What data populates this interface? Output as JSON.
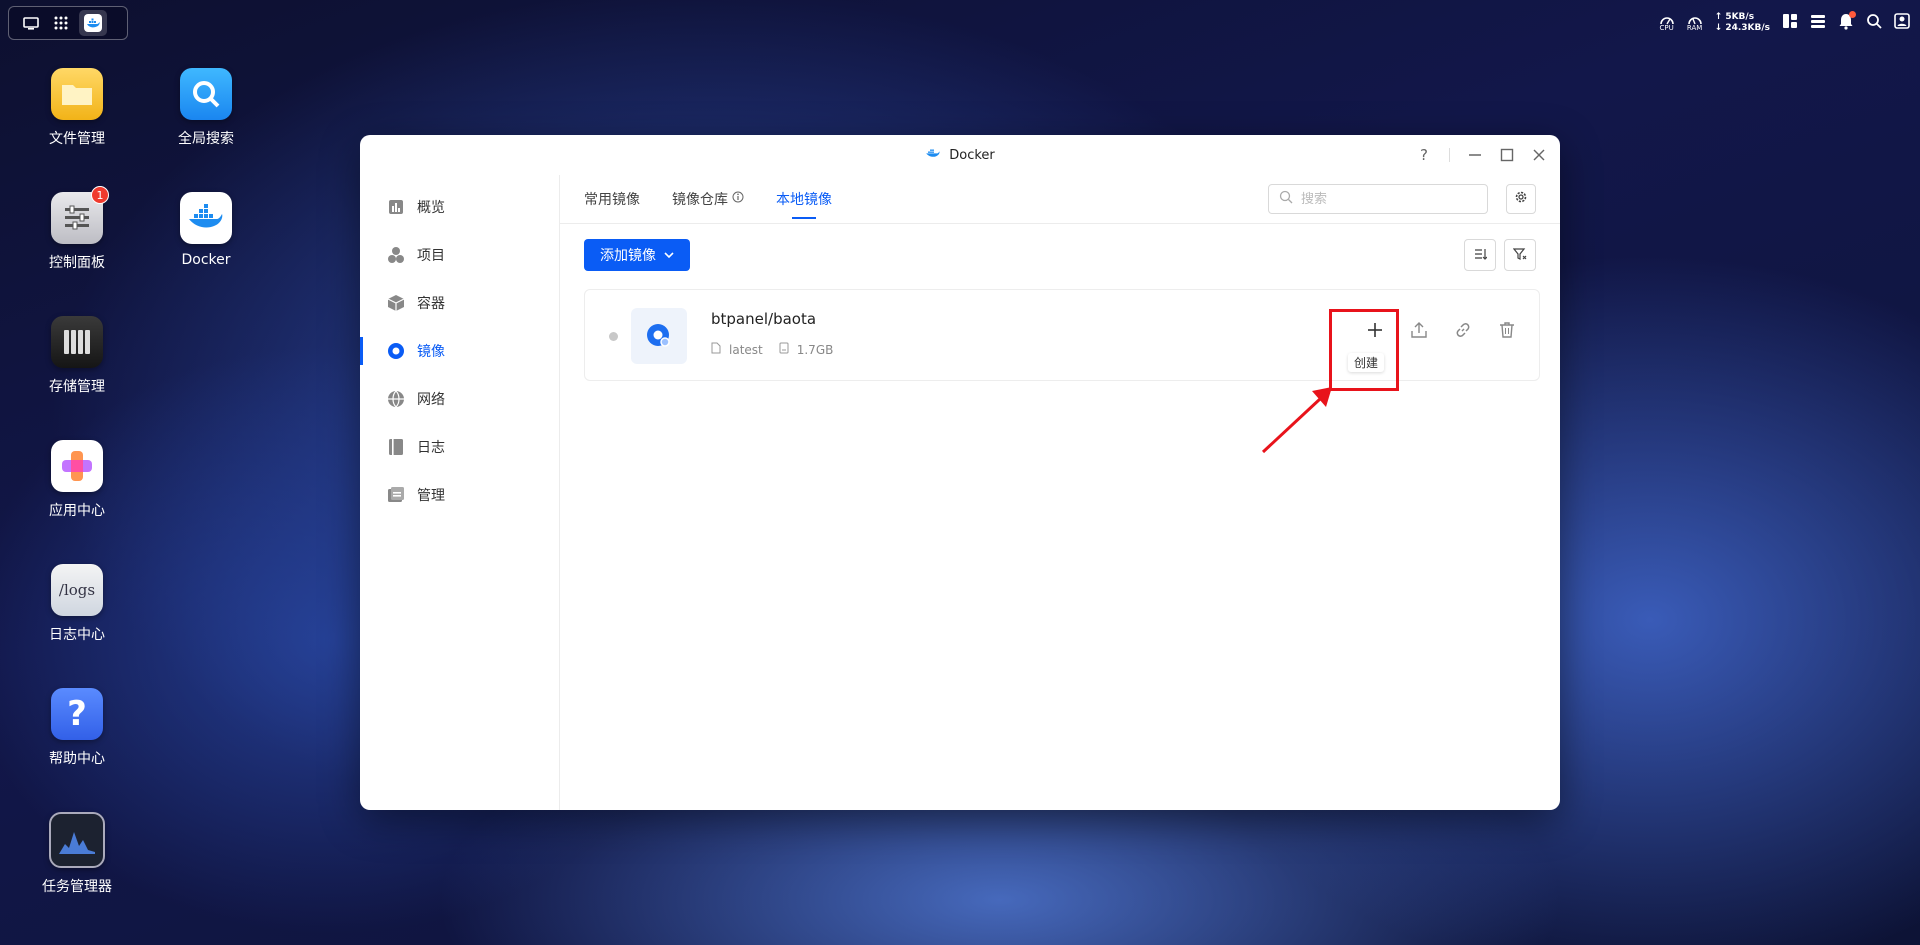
{
  "topbar": {
    "cpu_label": "CPU",
    "ram_label": "RAM",
    "upload_speed": "↑ 5KB/s",
    "download_speed": "↓ 24.3KB/s"
  },
  "desktop": {
    "icons": [
      {
        "label": "文件管理"
      },
      {
        "label": "全局搜索"
      },
      {
        "label": "控制面板",
        "badge": "1"
      },
      {
        "label": "Docker"
      },
      {
        "label": "存储管理"
      },
      {
        "label": "应用中心"
      },
      {
        "label": "日志中心",
        "tile_text": "/logs"
      },
      {
        "label": "帮助中心",
        "tile_text": "?"
      },
      {
        "label": "任务管理器"
      }
    ]
  },
  "window": {
    "title": "Docker",
    "help_label": "?"
  },
  "sidebar": {
    "items": [
      {
        "label": "概览"
      },
      {
        "label": "项目"
      },
      {
        "label": "容器"
      },
      {
        "label": "镜像"
      },
      {
        "label": "网络"
      },
      {
        "label": "日志"
      },
      {
        "label": "管理"
      }
    ]
  },
  "tabs": [
    {
      "label": "常用镜像"
    },
    {
      "label": "镜像仓库"
    },
    {
      "label": "本地镜像"
    }
  ],
  "search": {
    "placeholder": "搜索"
  },
  "toolbar": {
    "add_label": "添加镜像"
  },
  "image": {
    "name": "btpanel/baota",
    "tag": "latest",
    "size": "1.7GB"
  },
  "tooltip": {
    "create_label": "创建"
  },
  "colors": {
    "accent": "#0a5cf5",
    "highlight": "#e8131b"
  }
}
